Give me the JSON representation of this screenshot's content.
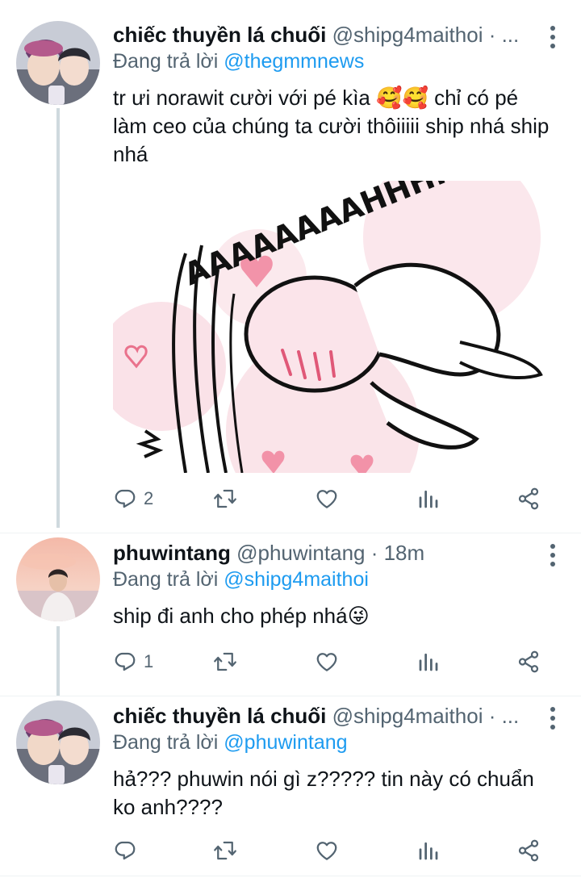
{
  "tweets": [
    {
      "name": "chiếc thuyền lá chuối",
      "handle": "@shipg4maithoi · ...",
      "reply_prefix": "Đang trả lời ",
      "reply_to": "@thegmmnews",
      "text": "tr ưi norawit cười với pé kìa 🥰🥰 chỉ có pé làm ceo của chúng ta cười thôiiiii ship nhá ship nhá",
      "media_text": "AAAAAAAAHHHHHHHH",
      "reply_count": "2"
    },
    {
      "name": "phuwintang",
      "handle": "@phuwintang · 18m",
      "reply_prefix": "Đang trả lời ",
      "reply_to": "@shipg4maithoi",
      "text": "ship đi anh cho phép nhá😜",
      "reply_count": "1"
    },
    {
      "name": "chiếc thuyền lá chuối",
      "handle": "@shipg4maithoi · ...",
      "reply_prefix": "Đang trả lời ",
      "reply_to": "@phuwintang",
      "text": "hả??? phuwin nói gì z????? tin này có chuẩn ko anh????",
      "reply_count": ""
    }
  ],
  "icons": [
    "reply-icon",
    "retweet-icon",
    "like-icon",
    "analytics-icon",
    "share-icon",
    "more-icon"
  ],
  "colors": {
    "link": "#1d9bf0",
    "secondary": "#536471",
    "text": "#0f1419",
    "thread_line": "#cfd9de"
  }
}
